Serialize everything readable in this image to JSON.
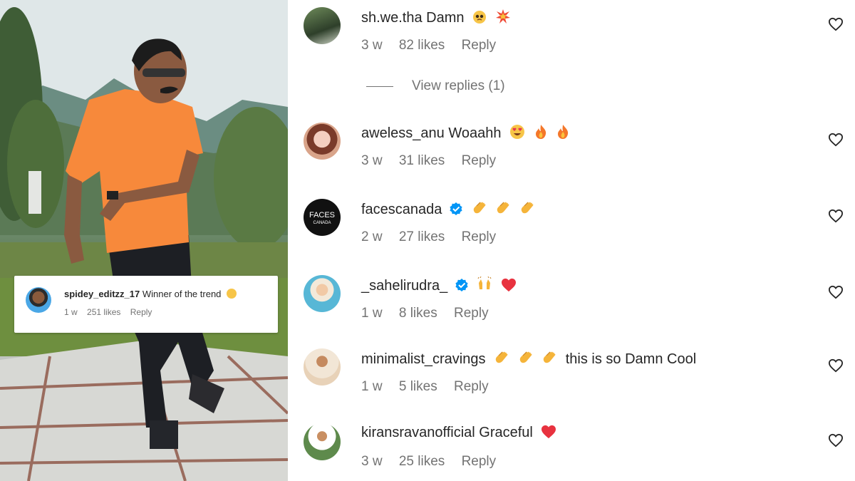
{
  "video_overlay": {
    "username": "spidey_editzz_17",
    "text": "Winner of the trend",
    "time": "1 w",
    "likes": "251 likes",
    "reply": "Reply"
  },
  "comments": [
    {
      "username": "sh.we.tha",
      "text": "Damn",
      "time": "3 w",
      "likes": "82 likes",
      "reply": "Reply",
      "emojis": [
        "pleading-face",
        "collision"
      ],
      "verified": false
    },
    {
      "username": "aweless_anu",
      "text": "Woaahh",
      "time": "3 w",
      "likes": "31 likes",
      "reply": "Reply",
      "emojis": [
        "heart-eyes",
        "fire",
        "fire"
      ],
      "verified": false
    },
    {
      "username": "facescanada",
      "text": "",
      "time": "2 w",
      "likes": "27 likes",
      "reply": "Reply",
      "emojis": [
        "clap",
        "clap",
        "clap"
      ],
      "verified": true,
      "avatar_text": [
        "FACES",
        "CANADA"
      ]
    },
    {
      "username": "_sahelirudra_",
      "text": "",
      "time": "1 w",
      "likes": "8 likes",
      "reply": "Reply",
      "emojis": [
        "raised-hands",
        "red-heart"
      ],
      "verified": true
    },
    {
      "username": "minimalist_cravings",
      "text": "this is so Damn Cool",
      "time": "1 w",
      "likes": "5 likes",
      "reply": "Reply",
      "emojis": [
        "clap",
        "clap",
        "clap"
      ],
      "verified": false
    },
    {
      "username": "kiransravanofficial",
      "text": "Graceful",
      "time": "3 w",
      "likes": "25 likes",
      "reply": "Reply",
      "emojis": [
        "red-heart"
      ],
      "verified": false
    }
  ],
  "view_replies": "View replies (1)",
  "icons": {
    "like": "heart-outline-icon",
    "verified": "verified-badge-icon"
  },
  "colors": {
    "text": "#262626",
    "secondary": "#737373",
    "verified": "#0095f6",
    "shirt": "#f7893b"
  }
}
